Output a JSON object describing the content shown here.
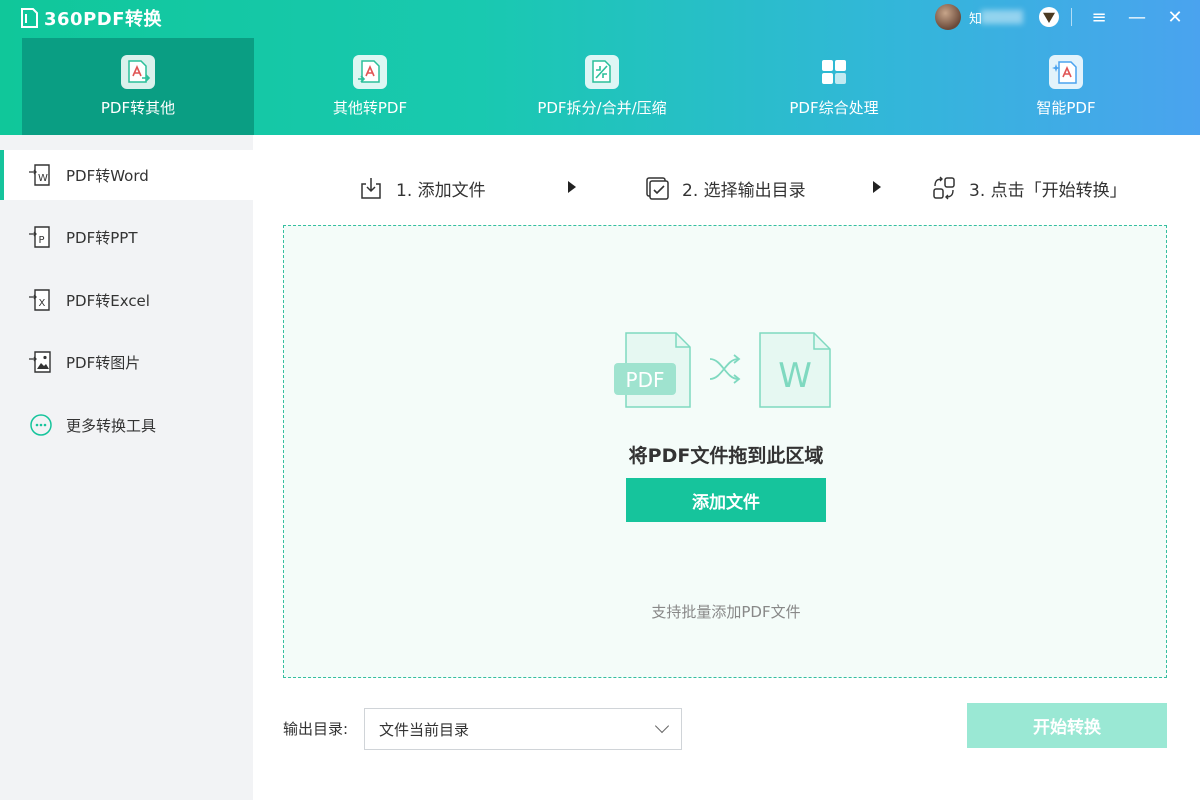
{
  "app": {
    "title": "360PDF转换"
  },
  "user": {
    "name": "知"
  },
  "window_controls": {
    "menu": "≡",
    "minimize": "—",
    "close": "✕"
  },
  "tabs": [
    {
      "label": "PDF转其他",
      "icon": "pdf-export-icon",
      "active": true
    },
    {
      "label": "其他转PDF",
      "icon": "pdf-import-icon",
      "active": false
    },
    {
      "label": "PDF拆分/合并/压缩",
      "icon": "pdf-split-merge-icon",
      "active": false
    },
    {
      "label": "PDF综合处理",
      "icon": "grid-tools-icon",
      "active": false
    },
    {
      "label": "智能PDF",
      "icon": "ai-pdf-icon",
      "active": false
    }
  ],
  "sidebar": {
    "items": [
      {
        "label": "PDF转Word",
        "icon": "word-icon",
        "active": true
      },
      {
        "label": "PDF转PPT",
        "icon": "ppt-icon",
        "active": false
      },
      {
        "label": "PDF转Excel",
        "icon": "excel-icon",
        "active": false
      },
      {
        "label": "PDF转图片",
        "icon": "image-icon",
        "active": false
      },
      {
        "label": "更多转换工具",
        "icon": "more-icon",
        "active": false
      }
    ]
  },
  "steps": [
    {
      "label": "1. 添加文件",
      "icon": "download-icon"
    },
    {
      "label": "2. 选择输出目录",
      "icon": "checkbox-icon"
    },
    {
      "label": "3. 点击「开始转换」",
      "icon": "convert-icon"
    }
  ],
  "dropzone": {
    "illustration_left": "PDF",
    "illustration_right": "W",
    "title": "将PDF文件拖到此区域",
    "add_button": "添加文件",
    "hint": "支持批量添加PDF文件"
  },
  "output": {
    "label": "输出目录:",
    "selected": "文件当前目录"
  },
  "start_button": "开始转换",
  "colors": {
    "accent": "#16c49c",
    "active_tab": "#0a9e83",
    "disabled_button": "#9ae8d4"
  }
}
